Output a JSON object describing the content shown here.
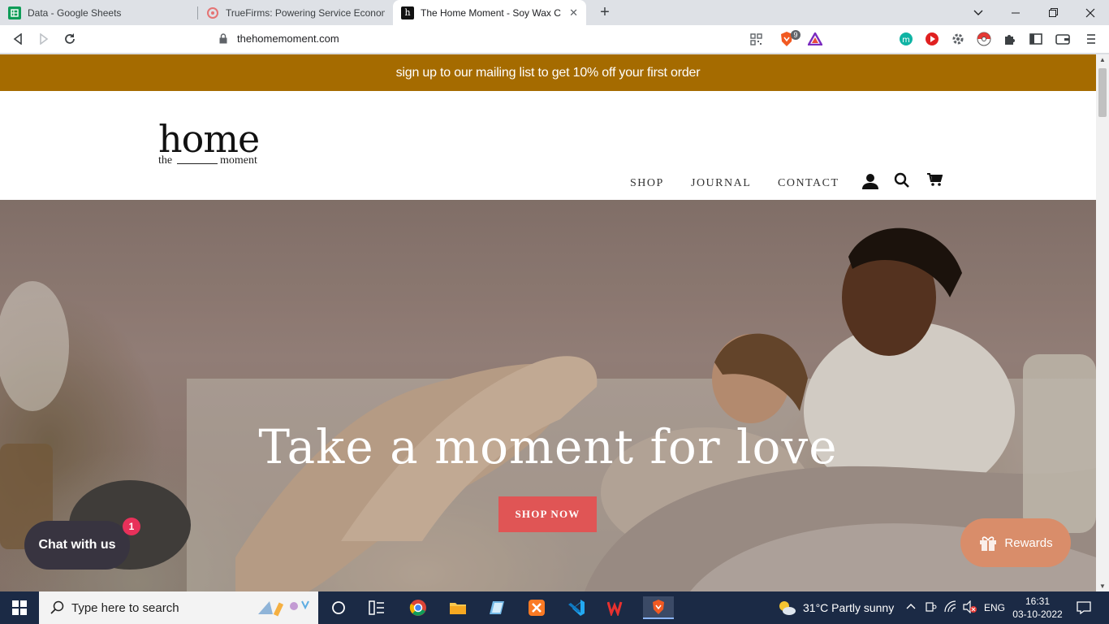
{
  "browser": {
    "tabs": [
      {
        "title": "Data - Google Sheets"
      },
      {
        "title": "TrueFirms: Powering Service Economy"
      },
      {
        "title": "The Home Moment - Soy Wax Ca"
      }
    ],
    "url": "thehomemoment.com",
    "brave_badge": "9"
  },
  "site": {
    "promo_text": "sign up to our mailing list to get 10% off your first order",
    "logo": {
      "word": "home",
      "the": "the",
      "moment": "moment"
    },
    "nav": [
      "SHOP",
      "JOURNAL",
      "CONTACT"
    ],
    "hero": {
      "title": "Take a moment for love",
      "cta": "SHOP NOW"
    },
    "chat": {
      "label": "Chat with us",
      "badge": "1"
    },
    "rewards": {
      "label": "Rewards"
    },
    "colors": {
      "promo_bg": "#a56b00",
      "cta_bg": "#e05555",
      "rewards_bg": "#d98d6a",
      "chat_bg": "#383440"
    }
  },
  "taskbar": {
    "search_placeholder": "Type here to search",
    "weather": "31°C  Partly sunny",
    "language": "ENG",
    "time": "16:31",
    "date": "03-10-2022"
  }
}
